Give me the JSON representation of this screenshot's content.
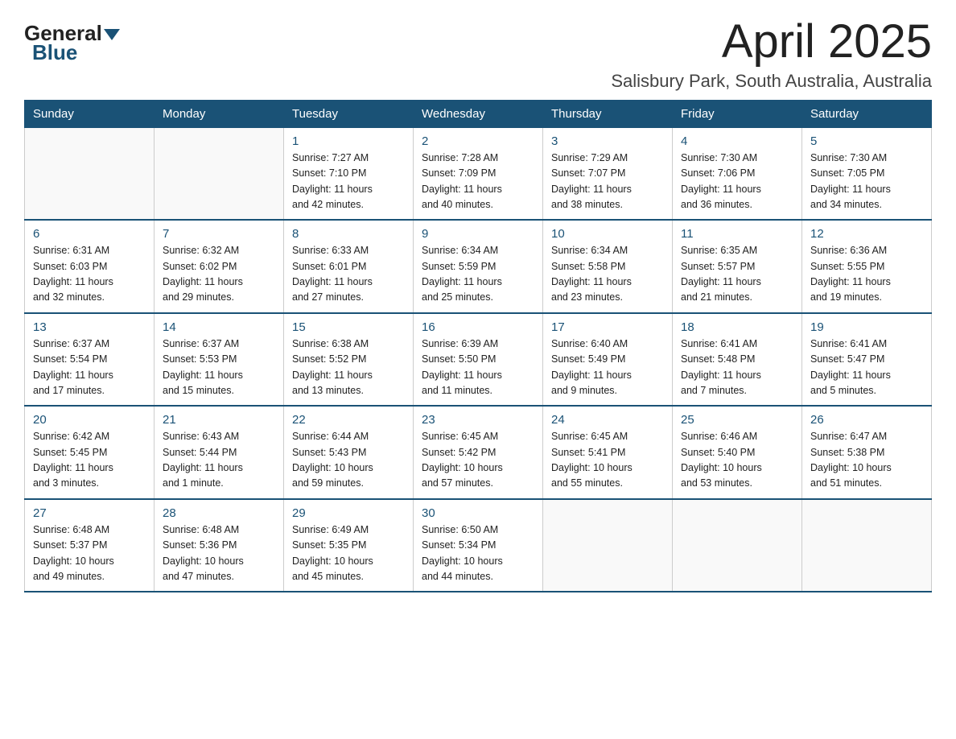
{
  "header": {
    "logo": {
      "general": "General",
      "blue": "Blue"
    },
    "title": "April 2025",
    "subtitle": "Salisbury Park, South Australia, Australia"
  },
  "calendar": {
    "weekdays": [
      "Sunday",
      "Monday",
      "Tuesday",
      "Wednesday",
      "Thursday",
      "Friday",
      "Saturday"
    ],
    "weeks": [
      [
        {
          "day": "",
          "info": ""
        },
        {
          "day": "",
          "info": ""
        },
        {
          "day": "1",
          "info": "Sunrise: 7:27 AM\nSunset: 7:10 PM\nDaylight: 11 hours\nand 42 minutes."
        },
        {
          "day": "2",
          "info": "Sunrise: 7:28 AM\nSunset: 7:09 PM\nDaylight: 11 hours\nand 40 minutes."
        },
        {
          "day": "3",
          "info": "Sunrise: 7:29 AM\nSunset: 7:07 PM\nDaylight: 11 hours\nand 38 minutes."
        },
        {
          "day": "4",
          "info": "Sunrise: 7:30 AM\nSunset: 7:06 PM\nDaylight: 11 hours\nand 36 minutes."
        },
        {
          "day": "5",
          "info": "Sunrise: 7:30 AM\nSunset: 7:05 PM\nDaylight: 11 hours\nand 34 minutes."
        }
      ],
      [
        {
          "day": "6",
          "info": "Sunrise: 6:31 AM\nSunset: 6:03 PM\nDaylight: 11 hours\nand 32 minutes."
        },
        {
          "day": "7",
          "info": "Sunrise: 6:32 AM\nSunset: 6:02 PM\nDaylight: 11 hours\nand 29 minutes."
        },
        {
          "day": "8",
          "info": "Sunrise: 6:33 AM\nSunset: 6:01 PM\nDaylight: 11 hours\nand 27 minutes."
        },
        {
          "day": "9",
          "info": "Sunrise: 6:34 AM\nSunset: 5:59 PM\nDaylight: 11 hours\nand 25 minutes."
        },
        {
          "day": "10",
          "info": "Sunrise: 6:34 AM\nSunset: 5:58 PM\nDaylight: 11 hours\nand 23 minutes."
        },
        {
          "day": "11",
          "info": "Sunrise: 6:35 AM\nSunset: 5:57 PM\nDaylight: 11 hours\nand 21 minutes."
        },
        {
          "day": "12",
          "info": "Sunrise: 6:36 AM\nSunset: 5:55 PM\nDaylight: 11 hours\nand 19 minutes."
        }
      ],
      [
        {
          "day": "13",
          "info": "Sunrise: 6:37 AM\nSunset: 5:54 PM\nDaylight: 11 hours\nand 17 minutes."
        },
        {
          "day": "14",
          "info": "Sunrise: 6:37 AM\nSunset: 5:53 PM\nDaylight: 11 hours\nand 15 minutes."
        },
        {
          "day": "15",
          "info": "Sunrise: 6:38 AM\nSunset: 5:52 PM\nDaylight: 11 hours\nand 13 minutes."
        },
        {
          "day": "16",
          "info": "Sunrise: 6:39 AM\nSunset: 5:50 PM\nDaylight: 11 hours\nand 11 minutes."
        },
        {
          "day": "17",
          "info": "Sunrise: 6:40 AM\nSunset: 5:49 PM\nDaylight: 11 hours\nand 9 minutes."
        },
        {
          "day": "18",
          "info": "Sunrise: 6:41 AM\nSunset: 5:48 PM\nDaylight: 11 hours\nand 7 minutes."
        },
        {
          "day": "19",
          "info": "Sunrise: 6:41 AM\nSunset: 5:47 PM\nDaylight: 11 hours\nand 5 minutes."
        }
      ],
      [
        {
          "day": "20",
          "info": "Sunrise: 6:42 AM\nSunset: 5:45 PM\nDaylight: 11 hours\nand 3 minutes."
        },
        {
          "day": "21",
          "info": "Sunrise: 6:43 AM\nSunset: 5:44 PM\nDaylight: 11 hours\nand 1 minute."
        },
        {
          "day": "22",
          "info": "Sunrise: 6:44 AM\nSunset: 5:43 PM\nDaylight: 10 hours\nand 59 minutes."
        },
        {
          "day": "23",
          "info": "Sunrise: 6:45 AM\nSunset: 5:42 PM\nDaylight: 10 hours\nand 57 minutes."
        },
        {
          "day": "24",
          "info": "Sunrise: 6:45 AM\nSunset: 5:41 PM\nDaylight: 10 hours\nand 55 minutes."
        },
        {
          "day": "25",
          "info": "Sunrise: 6:46 AM\nSunset: 5:40 PM\nDaylight: 10 hours\nand 53 minutes."
        },
        {
          "day": "26",
          "info": "Sunrise: 6:47 AM\nSunset: 5:38 PM\nDaylight: 10 hours\nand 51 minutes."
        }
      ],
      [
        {
          "day": "27",
          "info": "Sunrise: 6:48 AM\nSunset: 5:37 PM\nDaylight: 10 hours\nand 49 minutes."
        },
        {
          "day": "28",
          "info": "Sunrise: 6:48 AM\nSunset: 5:36 PM\nDaylight: 10 hours\nand 47 minutes."
        },
        {
          "day": "29",
          "info": "Sunrise: 6:49 AM\nSunset: 5:35 PM\nDaylight: 10 hours\nand 45 minutes."
        },
        {
          "day": "30",
          "info": "Sunrise: 6:50 AM\nSunset: 5:34 PM\nDaylight: 10 hours\nand 44 minutes."
        },
        {
          "day": "",
          "info": ""
        },
        {
          "day": "",
          "info": ""
        },
        {
          "day": "",
          "info": ""
        }
      ]
    ]
  }
}
